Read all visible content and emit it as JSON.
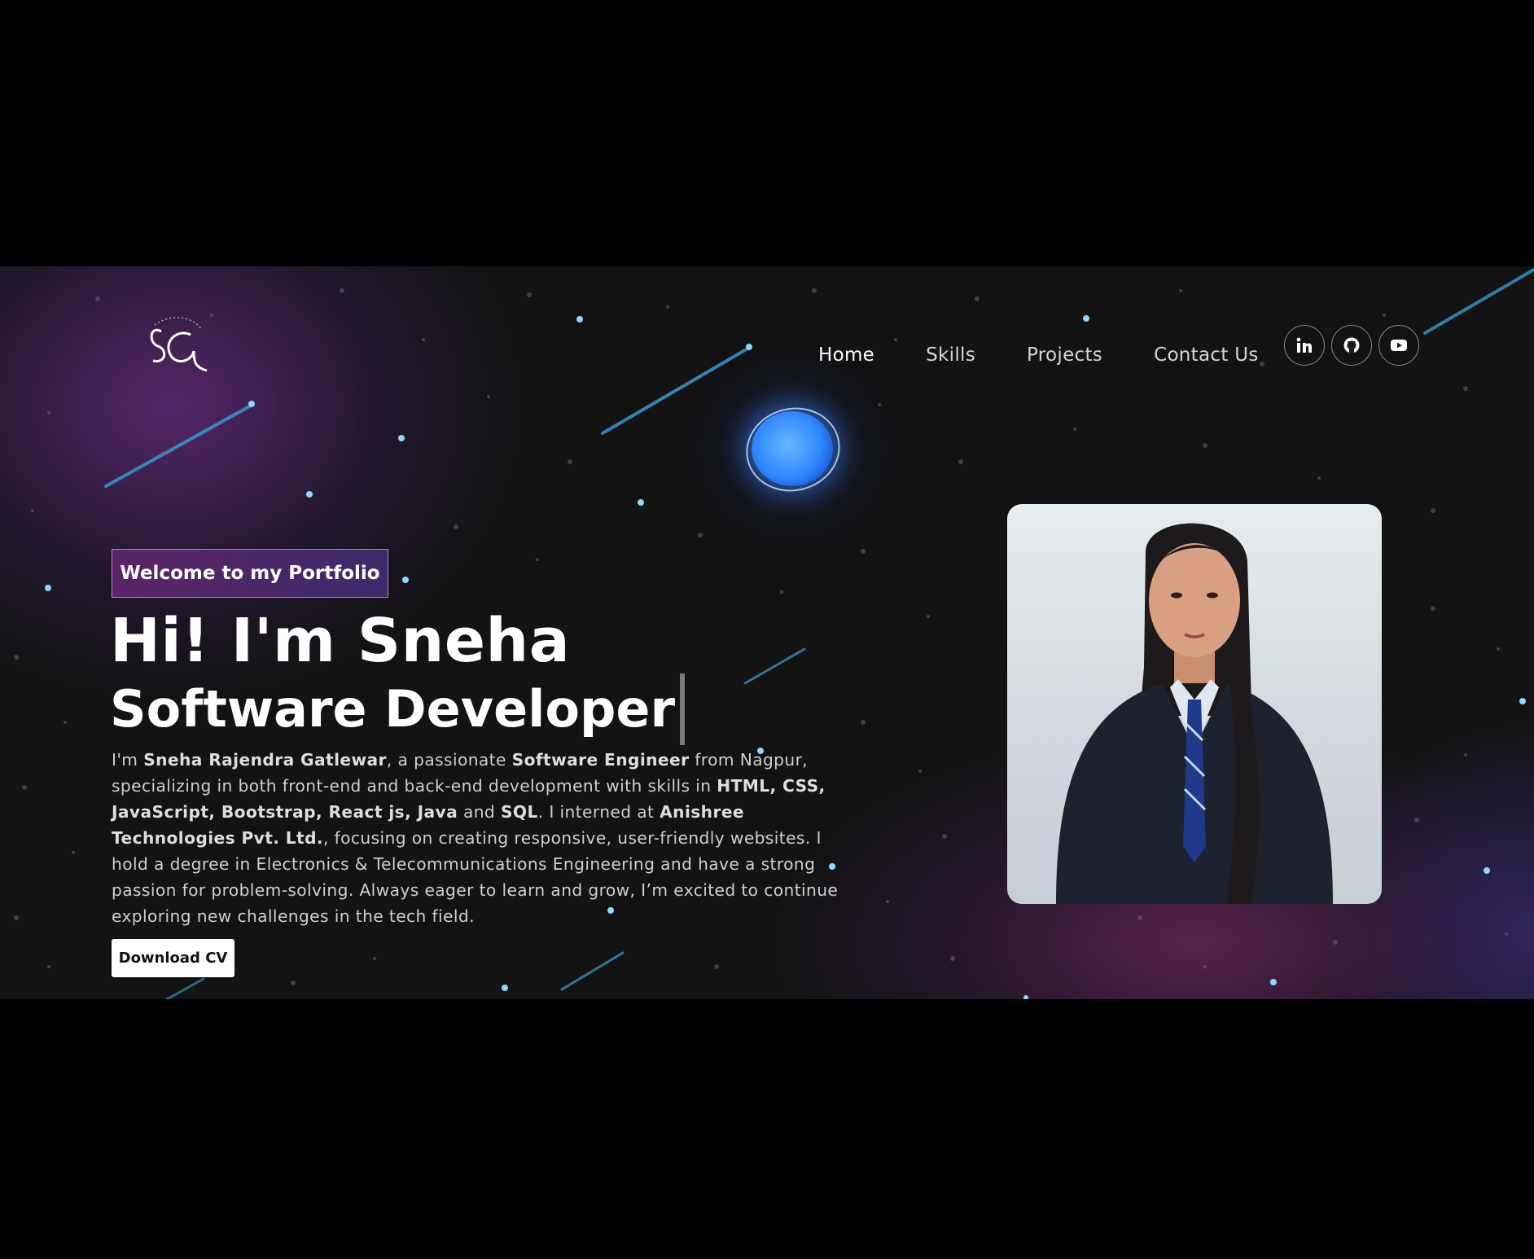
{
  "logo": {
    "text": "SG",
    "arc_text": "SNEHA GATLEWAR"
  },
  "nav": {
    "links": [
      {
        "label": "Home",
        "active": true
      },
      {
        "label": "Skills",
        "active": false
      },
      {
        "label": "Projects",
        "active": false
      },
      {
        "label": "Contact Us",
        "active": false
      }
    ],
    "socials": [
      "linkedin-icon",
      "github-icon",
      "youtube-icon"
    ]
  },
  "hero": {
    "badge": "Welcome to my Portfolio",
    "title": "Hi! I'm Sneha",
    "role": "Software Developer",
    "bio": {
      "p01": "I'm ",
      "b01": "Sneha Rajendra Gatlewar",
      "p02": ", a passionate ",
      "b02": "Software Engineer",
      "p03": " from Nagpur, specializing in both front-end and back-end development with skills in ",
      "b03": "HTML, CSS, JavaScript, Bootstrap, React js, Java",
      "p04": " and ",
      "b04": "SQL",
      "p05": ". I interned at ",
      "b05": "Anishree Technologies Pvt. Ltd.",
      "p06": ", focusing on creating responsive, user-friendly websites. I hold a degree in Electronics & Telecommunications Engineering and have a strong passion for problem-solving. Always eager to learn and grow, I’m excited to continue exploring new challenges in the tech field."
    },
    "cv_button": "Download CV"
  },
  "colors": {
    "background": "#131314",
    "accent_purple": "#5a2466",
    "orb_blue": "#2f86ff",
    "star": "#7fd3ff"
  }
}
